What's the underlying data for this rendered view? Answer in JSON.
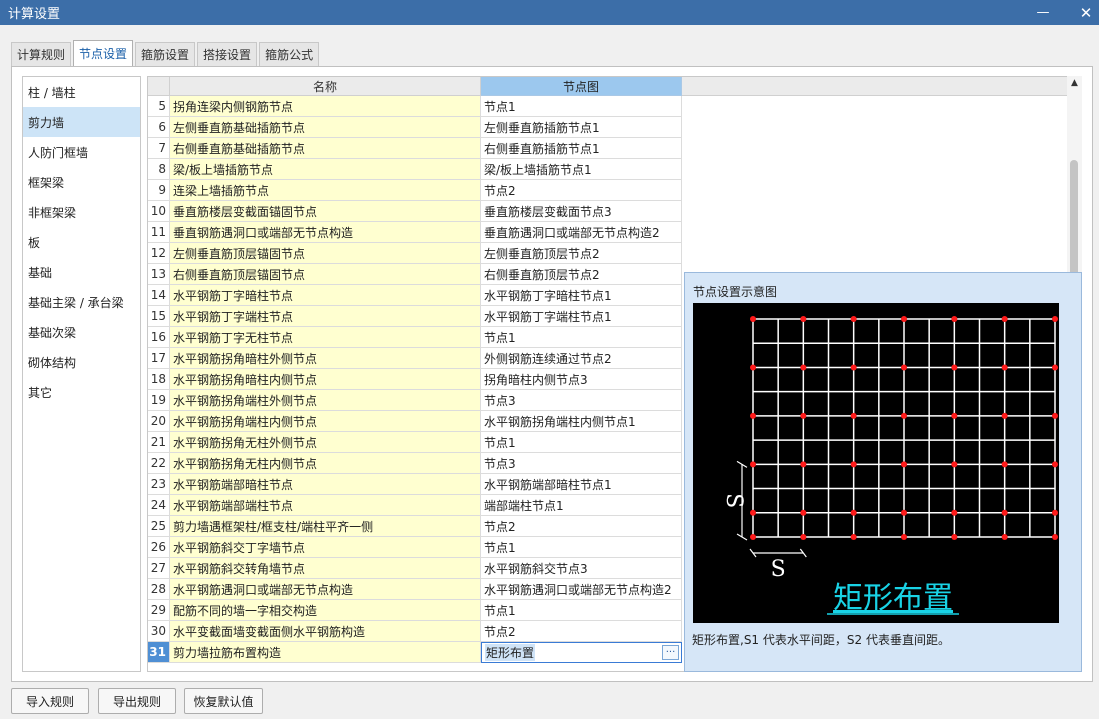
{
  "window": {
    "title": "计算设置",
    "minimize": "—",
    "close": "✕"
  },
  "tabs": [
    "计算规则",
    "节点设置",
    "箍筋设置",
    "搭接设置",
    "箍筋公式"
  ],
  "active_tab": 1,
  "sidebar": {
    "items": [
      "柱 / 墙柱",
      "剪力墙",
      "人防门框墙",
      "框架梁",
      "非框架梁",
      "板",
      "基础",
      "基础主梁 / 承台梁",
      "基础次梁",
      "砌体结构",
      "其它"
    ],
    "active_index": 1
  },
  "table": {
    "columns": {
      "name": "名称",
      "node": "节点图"
    },
    "rows": [
      {
        "idx": "5",
        "name": "拐角连梁内侧钢筋节点",
        "node": "节点1"
      },
      {
        "idx": "6",
        "name": "左侧垂直筋基础插筋节点",
        "node": "左侧垂直筋插筋节点1"
      },
      {
        "idx": "7",
        "name": "右侧垂直筋基础插筋节点",
        "node": "右侧垂直筋插筋节点1"
      },
      {
        "idx": "8",
        "name": "梁/板上墙插筋节点",
        "node": "梁/板上墙插筋节点1"
      },
      {
        "idx": "9",
        "name": "连梁上墙插筋节点",
        "node": "节点2"
      },
      {
        "idx": "10",
        "name": "垂直筋楼层变截面锚固节点",
        "node": "垂直筋楼层变截面节点3"
      },
      {
        "idx": "11",
        "name": "垂直钢筋遇洞口或端部无节点构造",
        "node": "垂直筋遇洞口或端部无节点构造2"
      },
      {
        "idx": "12",
        "name": "左侧垂直筋顶层锚固节点",
        "node": "左侧垂直筋顶层节点2"
      },
      {
        "idx": "13",
        "name": "右侧垂直筋顶层锚固节点",
        "node": "右侧垂直筋顶层节点2"
      },
      {
        "idx": "14",
        "name": "水平钢筋丁字暗柱节点",
        "node": "水平钢筋丁字暗柱节点1"
      },
      {
        "idx": "15",
        "name": "水平钢筋丁字端柱节点",
        "node": "水平钢筋丁字端柱节点1"
      },
      {
        "idx": "16",
        "name": "水平钢筋丁字无柱节点",
        "node": "节点1"
      },
      {
        "idx": "17",
        "name": "水平钢筋拐角暗柱外侧节点",
        "node": "外侧钢筋连续通过节点2"
      },
      {
        "idx": "18",
        "name": "水平钢筋拐角暗柱内侧节点",
        "node": "拐角暗柱内侧节点3"
      },
      {
        "idx": "19",
        "name": "水平钢筋拐角端柱外侧节点",
        "node": "节点3"
      },
      {
        "idx": "20",
        "name": "水平钢筋拐角端柱内侧节点",
        "node": "水平钢筋拐角端柱内侧节点1"
      },
      {
        "idx": "21",
        "name": "水平钢筋拐角无柱外侧节点",
        "node": "节点1"
      },
      {
        "idx": "22",
        "name": "水平钢筋拐角无柱内侧节点",
        "node": "节点3"
      },
      {
        "idx": "23",
        "name": "水平钢筋端部暗柱节点",
        "node": "水平钢筋端部暗柱节点1"
      },
      {
        "idx": "24",
        "name": "水平钢筋端部端柱节点",
        "node": "端部端柱节点1"
      },
      {
        "idx": "25",
        "name": "剪力墙遇框架柱/框支柱/端柱平齐一侧",
        "node": "节点2"
      },
      {
        "idx": "26",
        "name": "水平钢筋斜交丁字墙节点",
        "node": "节点1"
      },
      {
        "idx": "27",
        "name": "水平钢筋斜交转角墙节点",
        "node": "水平钢筋斜交节点3"
      },
      {
        "idx": "28",
        "name": "水平钢筋遇洞口或端部无节点构造",
        "node": "水平钢筋遇洞口或端部无节点构造2"
      },
      {
        "idx": "29",
        "name": "配筋不同的墙一字相交构造",
        "node": "节点1"
      },
      {
        "idx": "30",
        "name": "水平变截面墙变截面侧水平钢筋构造",
        "node": "节点2"
      },
      {
        "idx": "31",
        "name": "剪力墙拉筋布置构造",
        "node": "矩形布置"
      }
    ],
    "selected_index": 26,
    "ellipsis_label": "···"
  },
  "diagram": {
    "title": "节点设置示意图",
    "caption": "矩形布置",
    "label_s": "S",
    "description": "矩形布置,S1 代表水平间距，S2 代表垂直间距。",
    "colors": {
      "background": "#000000",
      "grid": "#ffffff",
      "dots": "#ff1a1a",
      "caption": "#19d3e6"
    }
  },
  "buttons": {
    "import": "导入规则",
    "export": "导出规则",
    "restore": "恢复默认值"
  }
}
